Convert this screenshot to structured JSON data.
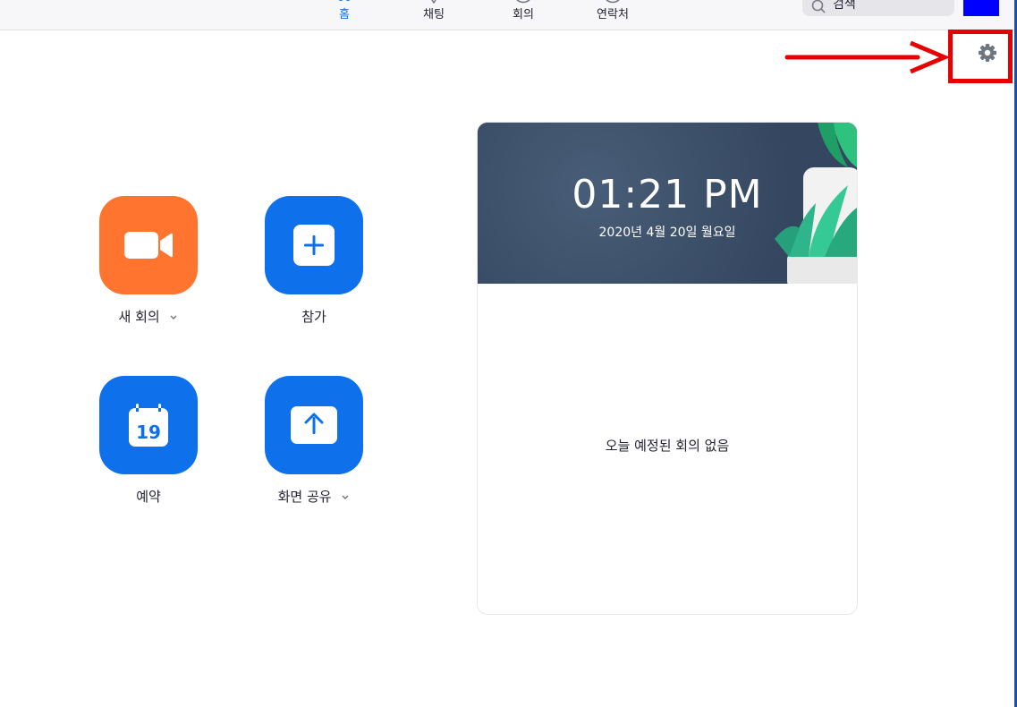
{
  "nav": {
    "tabs": [
      {
        "label": "홈",
        "icon": "home-icon"
      },
      {
        "label": "채팅",
        "icon": "chat-icon"
      },
      {
        "label": "회의",
        "icon": "meetings-icon"
      },
      {
        "label": "연락처",
        "icon": "contacts-icon"
      }
    ],
    "search_value": "검색",
    "avatar_color": "#0000ff"
  },
  "settings": {
    "icon": "gear-icon",
    "highlight_color": "#e60000"
  },
  "actions": [
    {
      "label": "새 회의",
      "icon": "video-camera-icon",
      "color": "#ff742e",
      "has_dropdown": true
    },
    {
      "label": "참가",
      "icon": "plus-icon",
      "color": "#0e71eb",
      "has_dropdown": false
    },
    {
      "label": "예약",
      "icon": "calendar-icon",
      "calendar_day": "19",
      "color": "#0e71eb",
      "has_dropdown": false
    },
    {
      "label": "화면 공유",
      "icon": "share-screen-icon",
      "color": "#0e71eb",
      "has_dropdown": true
    }
  ],
  "calendar_card": {
    "time": "01:21 PM",
    "date": "2020년 4월 20일 월요일",
    "empty_message": "오늘 예정된 회의 없음"
  },
  "colors": {
    "accent": "#0e72ed",
    "banner": "#3d5068"
  }
}
